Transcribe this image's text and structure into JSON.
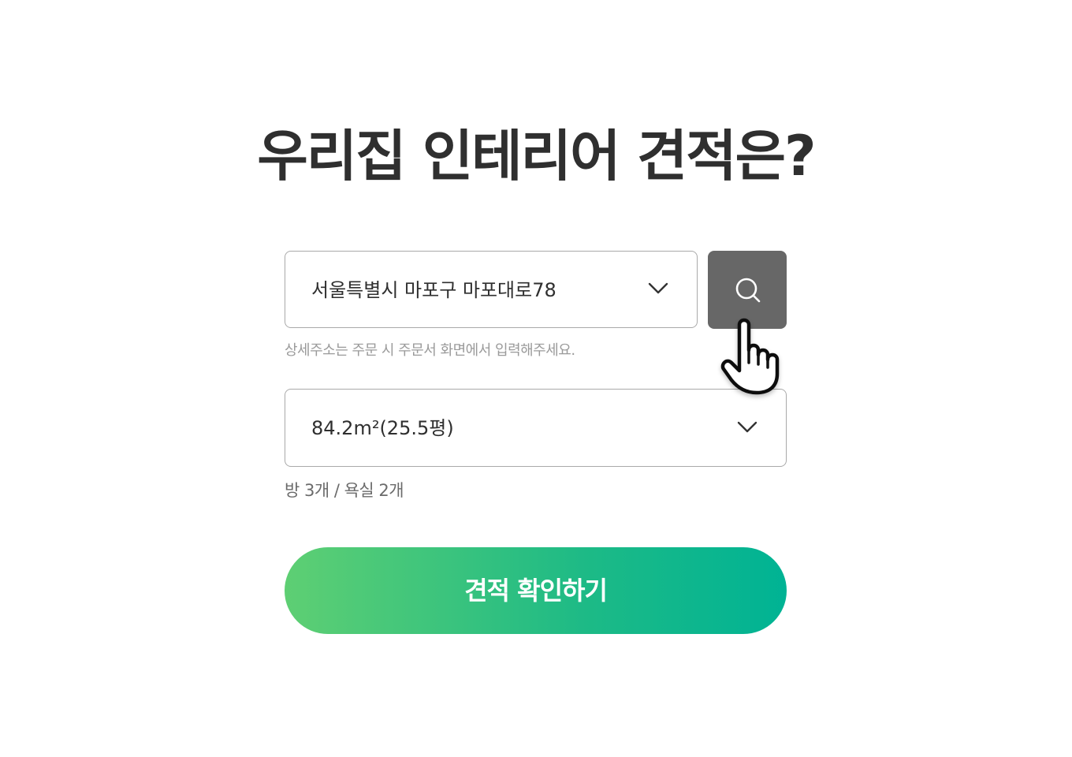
{
  "title": "우리집 인테리어 견적은?",
  "address": {
    "value": "서울특별시 마포구 마포대로78",
    "dropdown_icon": "chevron-down-icon",
    "search_icon": "search-icon",
    "hint": "상세주소는 주문 시 주문서 화면에서 입력해주세요."
  },
  "area": {
    "value": "84.2m²(25.5평)",
    "dropdown_icon": "chevron-down-icon",
    "rooms": "방 3개 / 욕실 2개"
  },
  "cta": {
    "label": "견적 확인하기"
  },
  "colors": {
    "title": "#2f2f2f",
    "search_button": "#676767",
    "cta_gradient_start": "#5ecf73",
    "cta_gradient_end": "#00b394",
    "hint_text": "#9a9a9a"
  },
  "cursor_icon": "hand-pointer-icon"
}
